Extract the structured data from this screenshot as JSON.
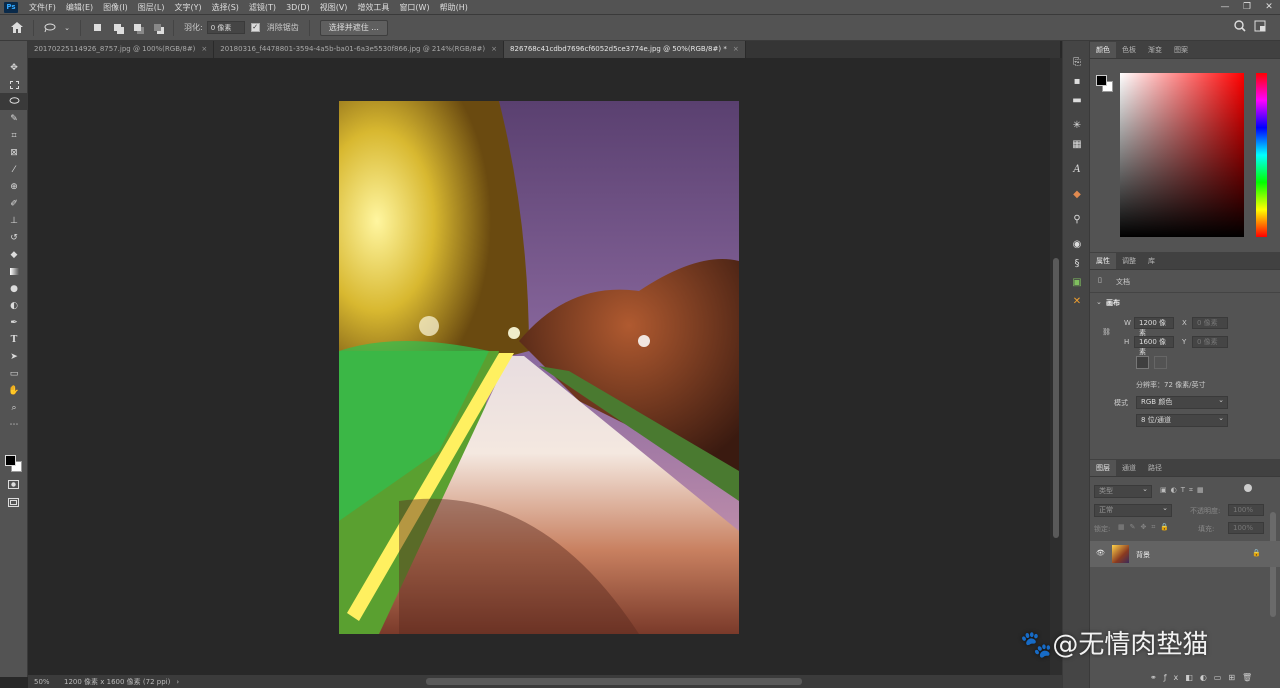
{
  "menubar": {
    "app_icon": "Ps",
    "items": [
      "文件(F)",
      "编辑(E)",
      "图像(I)",
      "图层(L)",
      "文字(Y)",
      "选择(S)",
      "滤镜(T)",
      "3D(D)",
      "视图(V)",
      "增效工具",
      "窗口(W)",
      "帮助(H)"
    ],
    "window_controls": [
      "—",
      "❐",
      "✕"
    ]
  },
  "options": {
    "feather_label": "羽化:",
    "feather_value": "0 像素",
    "antialias_label": "消除锯齿",
    "select_mask_button": "选择并遮住 ..."
  },
  "tabs": [
    {
      "label": "20170225114926_8757.jpg @ 100%(RGB/8#)",
      "close": "×"
    },
    {
      "label": "20180316_f4478801-3594-4a5b-ba01-6a3e5530f866.jpg @ 214%(RGB/8#)",
      "close": "×"
    },
    {
      "label": "826768c41cdbd7696cf6052d5ce3774e.jpg @ 50%(RGB/8#) *",
      "close": "×"
    }
  ],
  "status": {
    "zoom": "50%",
    "doc_info": "1200 像素 x 1600 像素 (72 ppi)",
    "arrow": "›"
  },
  "color_panel": {
    "tabs": [
      "颜色",
      "色板",
      "渐变",
      "图案"
    ],
    "colors": {
      "fg": "#000000",
      "bg": "#ffffff",
      "hue": "#ff0000"
    }
  },
  "properties_panel": {
    "tabs": [
      "属性",
      "调整",
      "库"
    ],
    "doc_label": "文档",
    "canvas_header": "画布",
    "w_label": "W",
    "w_value": "1200 像素",
    "h_label": "H",
    "h_value": "1600 像素",
    "x_label": "X",
    "x_value": "0 像素",
    "y_label": "Y",
    "y_value": "0 像素",
    "resolution": "分辨率：72 像素/英寸",
    "mode_label": "模式",
    "mode_value": "RGB 颜色",
    "depth_value": "8 位/通道"
  },
  "layers_panel": {
    "tabs": [
      "图层",
      "通道",
      "路径"
    ],
    "filter_placeholder": "类型",
    "blend_mode": "正常",
    "opacity_label": "不透明度:",
    "opacity_value": "100%",
    "lock_label": "锁定:",
    "fill_label": "填充:",
    "fill_value": "100%",
    "layer_name": "背景"
  },
  "watermark": "🐾@无情肉垫猫"
}
